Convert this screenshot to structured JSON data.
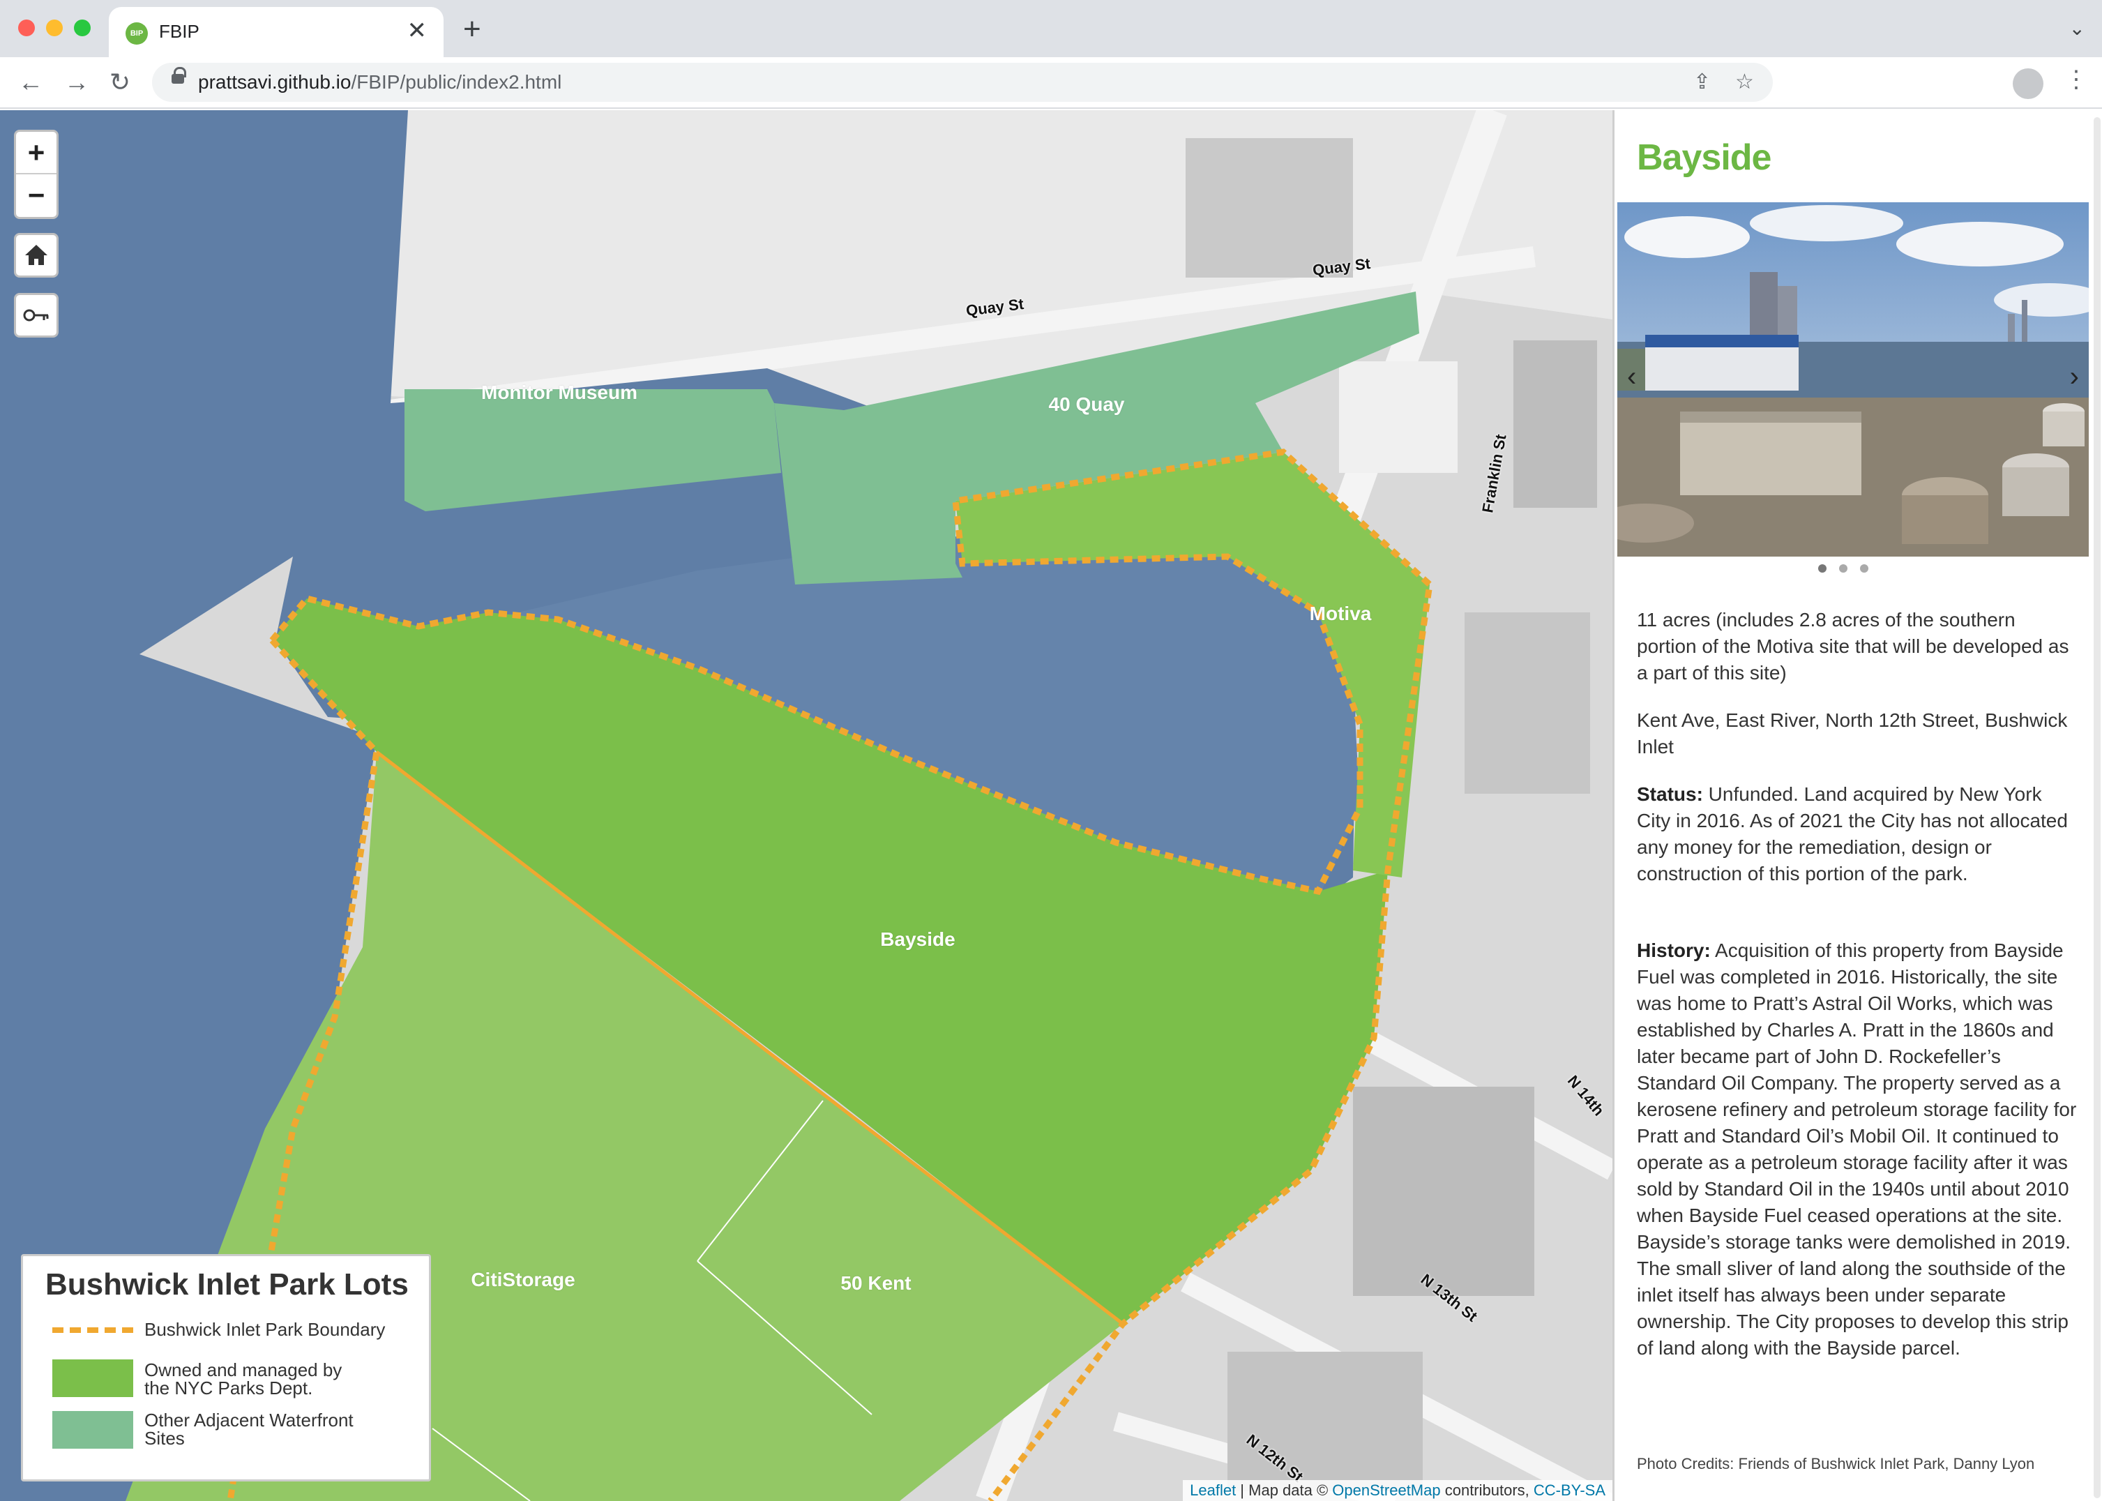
{
  "browser": {
    "tab_title": "FBIP",
    "tab_favicon": "BIP",
    "url_host": "prattsavi.github.io",
    "url_path": "/FBIP/public/index2.html",
    "new_tab": "+",
    "close": "✕",
    "back_icon": "←",
    "forward_icon": "→",
    "reload_icon": "↻",
    "share_icon": "⇪",
    "bookmark_icon": "☆",
    "menu_icon": "⋮",
    "tab_menu_icon": "⌄"
  },
  "map": {
    "zoom_in": "+",
    "zoom_out": "−",
    "home_icon": "home-icon",
    "key_icon": "key-icon",
    "lot_labels": {
      "monitor_museum": "Monitor Museum",
      "quay40": "40 Quay",
      "motiva": "Motiva",
      "bayside": "Bayside",
      "citistorage": "CitiStorage",
      "kent50": "50 Kent"
    },
    "streets": {
      "quay1": "Quay St",
      "quay2": "Quay St",
      "franklin": "Franklin St",
      "n14": "N 14th",
      "n13": "N 13th St",
      "n12": "N 12th St"
    },
    "attribution": {
      "leaflet": "Leaflet",
      "sep1": " | Map data © ",
      "osm": "OpenStreetMap",
      "sep2": " contributors, ",
      "license": "CC-BY-SA"
    },
    "colors": {
      "water": "#5f7ea6",
      "nyc_parks": "#7bbf4a",
      "nyc_parks_light": "#93c865",
      "other_sites": "#7fbf93",
      "boundary": "#f0a830"
    }
  },
  "legend": {
    "title": "Bushwick Inlet Park Lots",
    "boundary_label": "Bushwick Inlet Park Boundary",
    "owned_line1": "Owned and managed by",
    "owned_line2": "the NYC Parks Dept.",
    "other_line1": "Other Adjacent Waterfront",
    "other_line2": "Sites"
  },
  "panel": {
    "title": "Bayside",
    "photo_prev": "‹",
    "photo_next": "›",
    "size": "11 acres (includes 2.8 acres of the southern portion of the Motiva site that will be developed as a part of this site)",
    "location": "Kent Ave, East River, North 12th Street, Bushwick Inlet",
    "status_label": "Status:",
    "status_text": " Unfunded. Land acquired by New York City in 2016. As of 2021 the City has not allocated any money for the remediation, design or construction of this portion of the park.",
    "history_label": "History:",
    "history_text": " Acquisition of this property from Bayside Fuel was completed in 2016. Historically, the site was home to Pratt’s Astral Oil Works, which was established by Charles A. Pratt in the 1860s and later became part of John D. Rockefeller’s Standard Oil Company. The property served as a kerosene refinery and petroleum storage facility for Pratt and Standard Oil’s Mobil Oil. It continued to operate as a petroleum storage facility after it was sold by Standard Oil in the 1940s until about 2010 when Bayside Fuel ceased operations at the site. Bayside’s storage tanks were demolished in 2019. The small sliver of land along the southside of the inlet itself has always been under separate ownership. The City proposes to develop this strip of land along with the Bayside parcel.",
    "credits": "Photo Credits: Friends of Bushwick Inlet Park, Danny Lyon"
  }
}
